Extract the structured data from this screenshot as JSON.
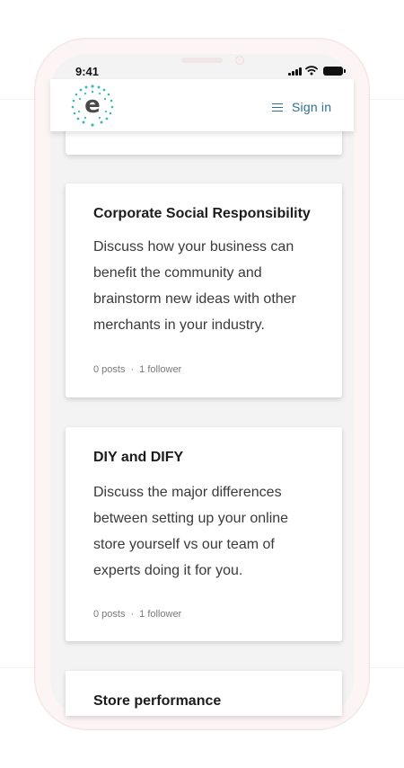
{
  "status_bar": {
    "time": "9:41"
  },
  "header": {
    "menu_label": "Sign in"
  },
  "cards": [
    {
      "title": "Corporate Social Responsibility",
      "description": "Discuss how your business can benefit the community and brainstorm new ideas with other merchants in your industry.",
      "posts": "0 posts",
      "followers": "1 follower"
    },
    {
      "title": "DIY and DIFY",
      "description": "Discuss the major differences between setting up your online store yourself vs our team of experts doing it for you.",
      "posts": "0 posts",
      "followers": "1 follower"
    },
    {
      "title": "Store performance"
    }
  ],
  "colors": {
    "accent": "#2d6f95",
    "logo_teal": "#3fb7bd"
  }
}
